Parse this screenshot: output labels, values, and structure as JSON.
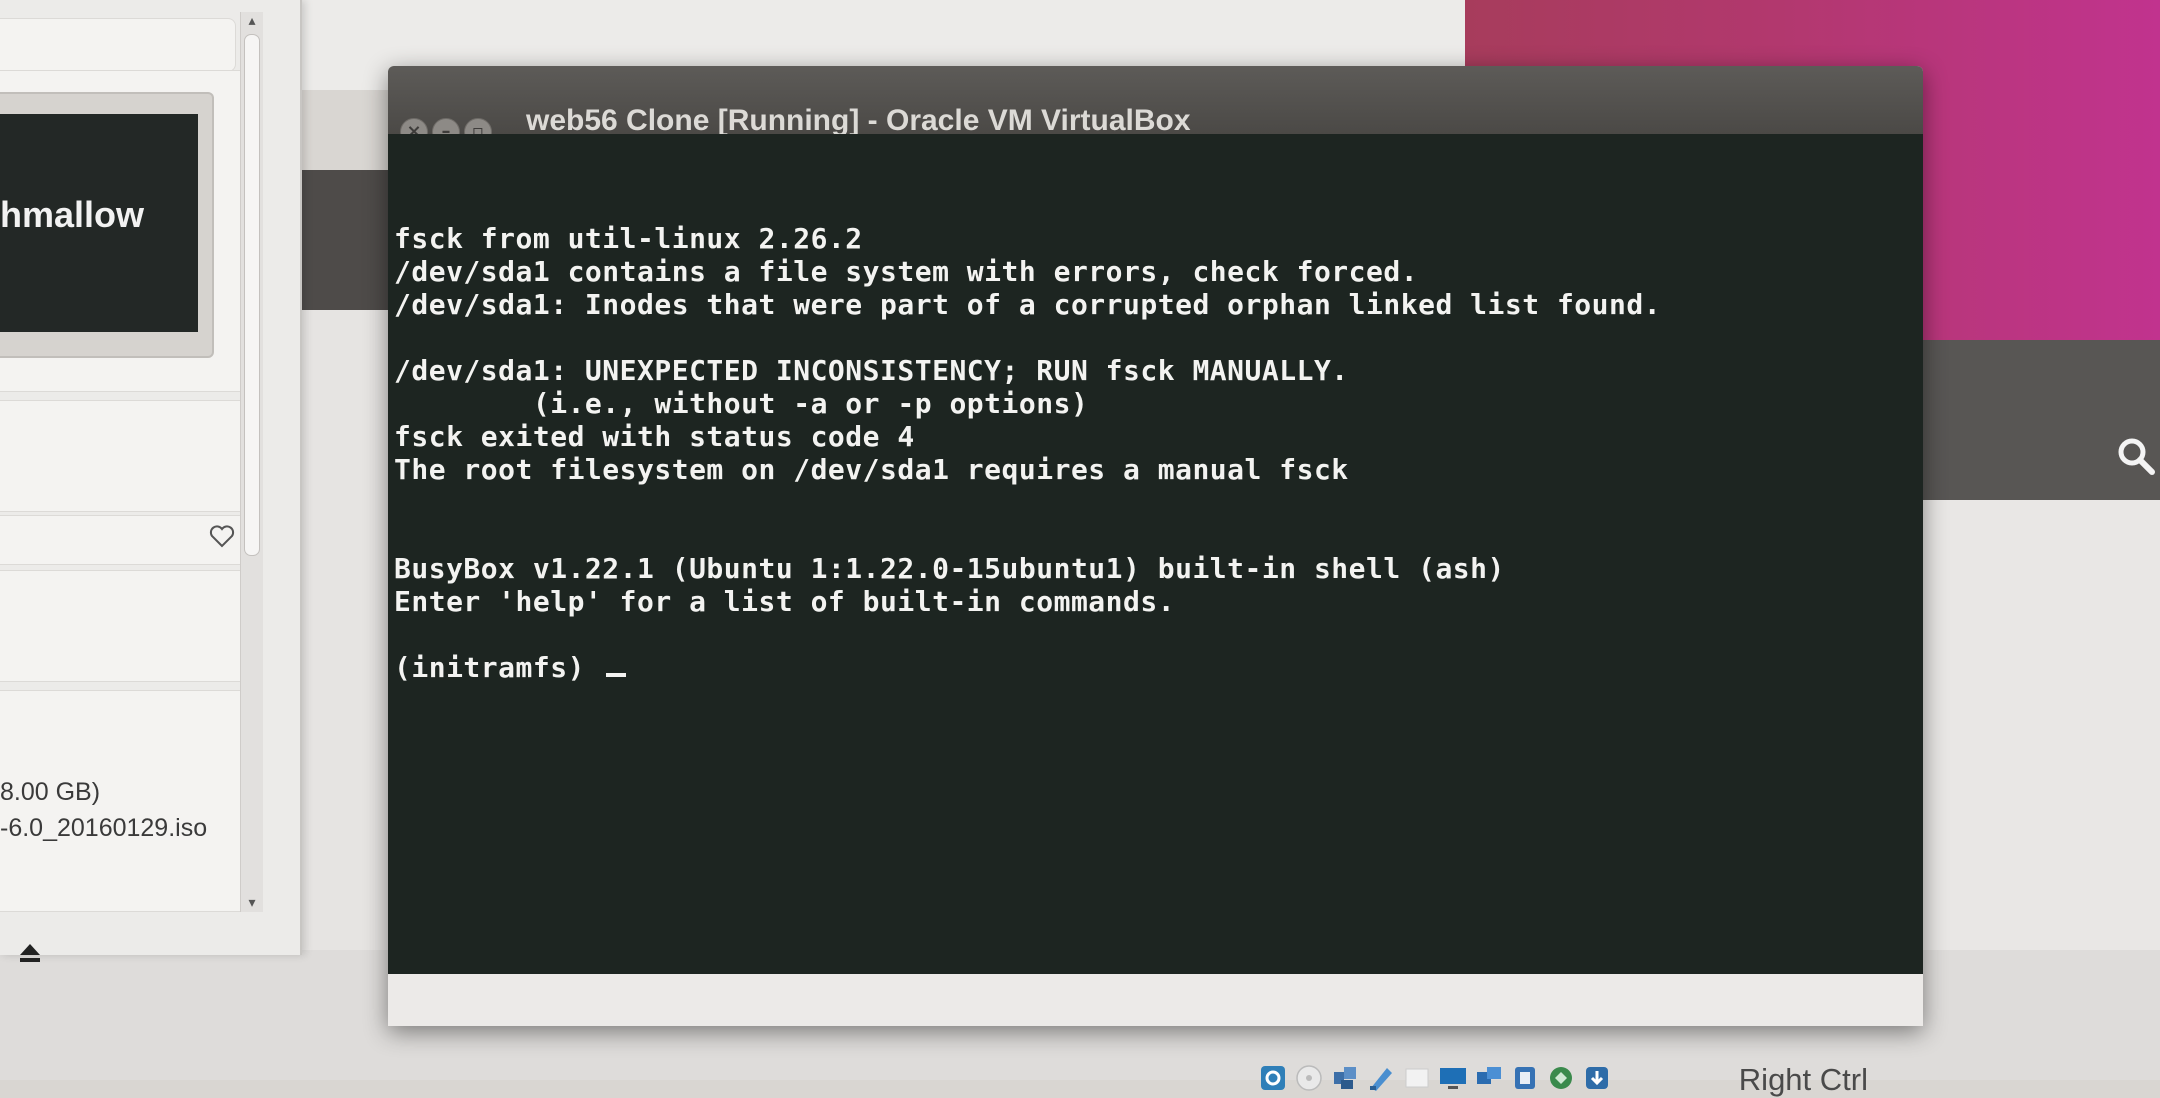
{
  "left_panel": {
    "vm_preview_label": "hmallow",
    "storage_size": "8.00 GB)",
    "iso_filename": "-6.0_20160129.iso"
  },
  "vm_window": {
    "title": "web56 Clone [Running] - Oracle VM VirtualBox",
    "console_lines": [
      "fsck from util-linux 2.26.2",
      "/dev/sda1 contains a file system with errors, check forced.",
      "/dev/sda1: Inodes that were part of a corrupted orphan linked list found.",
      "",
      "/dev/sda1: UNEXPECTED INCONSISTENCY; RUN fsck MANUALLY.",
      "        (i.e., without -a or -p options)",
      "fsck exited with status code 4",
      "The root filesystem on /dev/sda1 requires a manual fsck",
      "",
      "",
      "BusyBox v1.22.1 (Ubuntu 1:1.22.0-15ubuntu1) built-in shell (ash)",
      "Enter 'help' for a list of built-in commands.",
      "",
      "(initramfs) "
    ],
    "status_bar": {
      "icons": [
        "hard-disk-icon",
        "optical-drive-icon",
        "audio-icon",
        "network-icon",
        "usb-icon",
        "shared-folders-icon",
        "display-icon",
        "video-capture-icon",
        "cpu-icon",
        "mouse-integration-icon",
        "keyboard-capture-icon"
      ],
      "host_key": "Right Ctrl"
    }
  },
  "colors": {
    "console_bg": "#1d2521",
    "console_text": "#f3f3f1",
    "titlebar": "#4b4946",
    "desktop_accent": "#b2386e"
  }
}
